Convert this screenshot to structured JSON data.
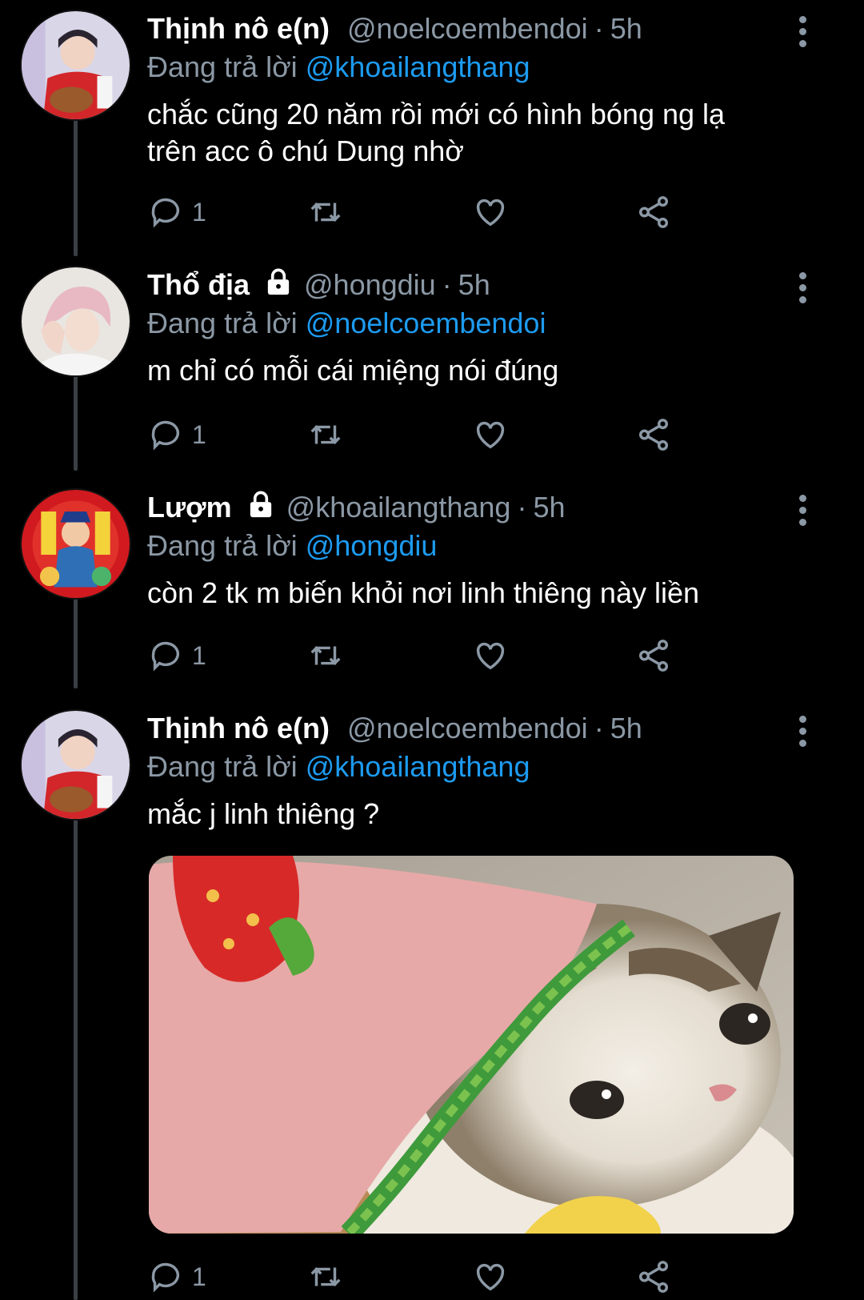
{
  "tweets": [
    {
      "name": "Thịnh nô e(n)",
      "handle": "@noelcoembendoi",
      "time": "5h",
      "replying_prefix": "Đang trả lời",
      "replying_to": "@khoailangthang",
      "text_lines": [
        "chắc cũng 20 năm rồi mới có hình bóng ng lạ",
        "trên acc ô chú Dung nhờ"
      ],
      "reply_count": "1",
      "locked": false
    },
    {
      "name": "Thổ địa",
      "handle": "@hongdiu",
      "time": "5h",
      "replying_prefix": "Đang trả lời",
      "replying_to": "@noelcoembendoi",
      "text_lines": [
        "m chỉ có mỗi cái miệng nói đúng"
      ],
      "reply_count": "1",
      "locked": true
    },
    {
      "name": "Lượm",
      "handle": "@khoailangthang",
      "time": "5h",
      "replying_prefix": "Đang trả lời",
      "replying_to": "@hongdiu",
      "text_lines": [
        "còn 2 tk m biến khỏi nơi linh thiêng này liền"
      ],
      "reply_count": "1",
      "locked": true
    },
    {
      "name": "Thịnh nô e(n)",
      "handle": "@noelcoembendoi",
      "time": "5h",
      "replying_prefix": "Đang trả lời",
      "replying_to": "@khoailangthang",
      "text_lines": [
        "mắc j linh thiêng ?"
      ],
      "reply_count": "1",
      "locked": false,
      "has_media": true
    }
  ],
  "icons": {
    "reply": "reply-icon",
    "retweet": "retweet-icon",
    "like": "heart-icon",
    "share": "share-icon",
    "more": "more-vertical-icon",
    "lock": "lock-icon"
  },
  "colors": {
    "background": "#000000",
    "secondary_text": "#8b98a5",
    "mention": "#1d9bf0"
  }
}
